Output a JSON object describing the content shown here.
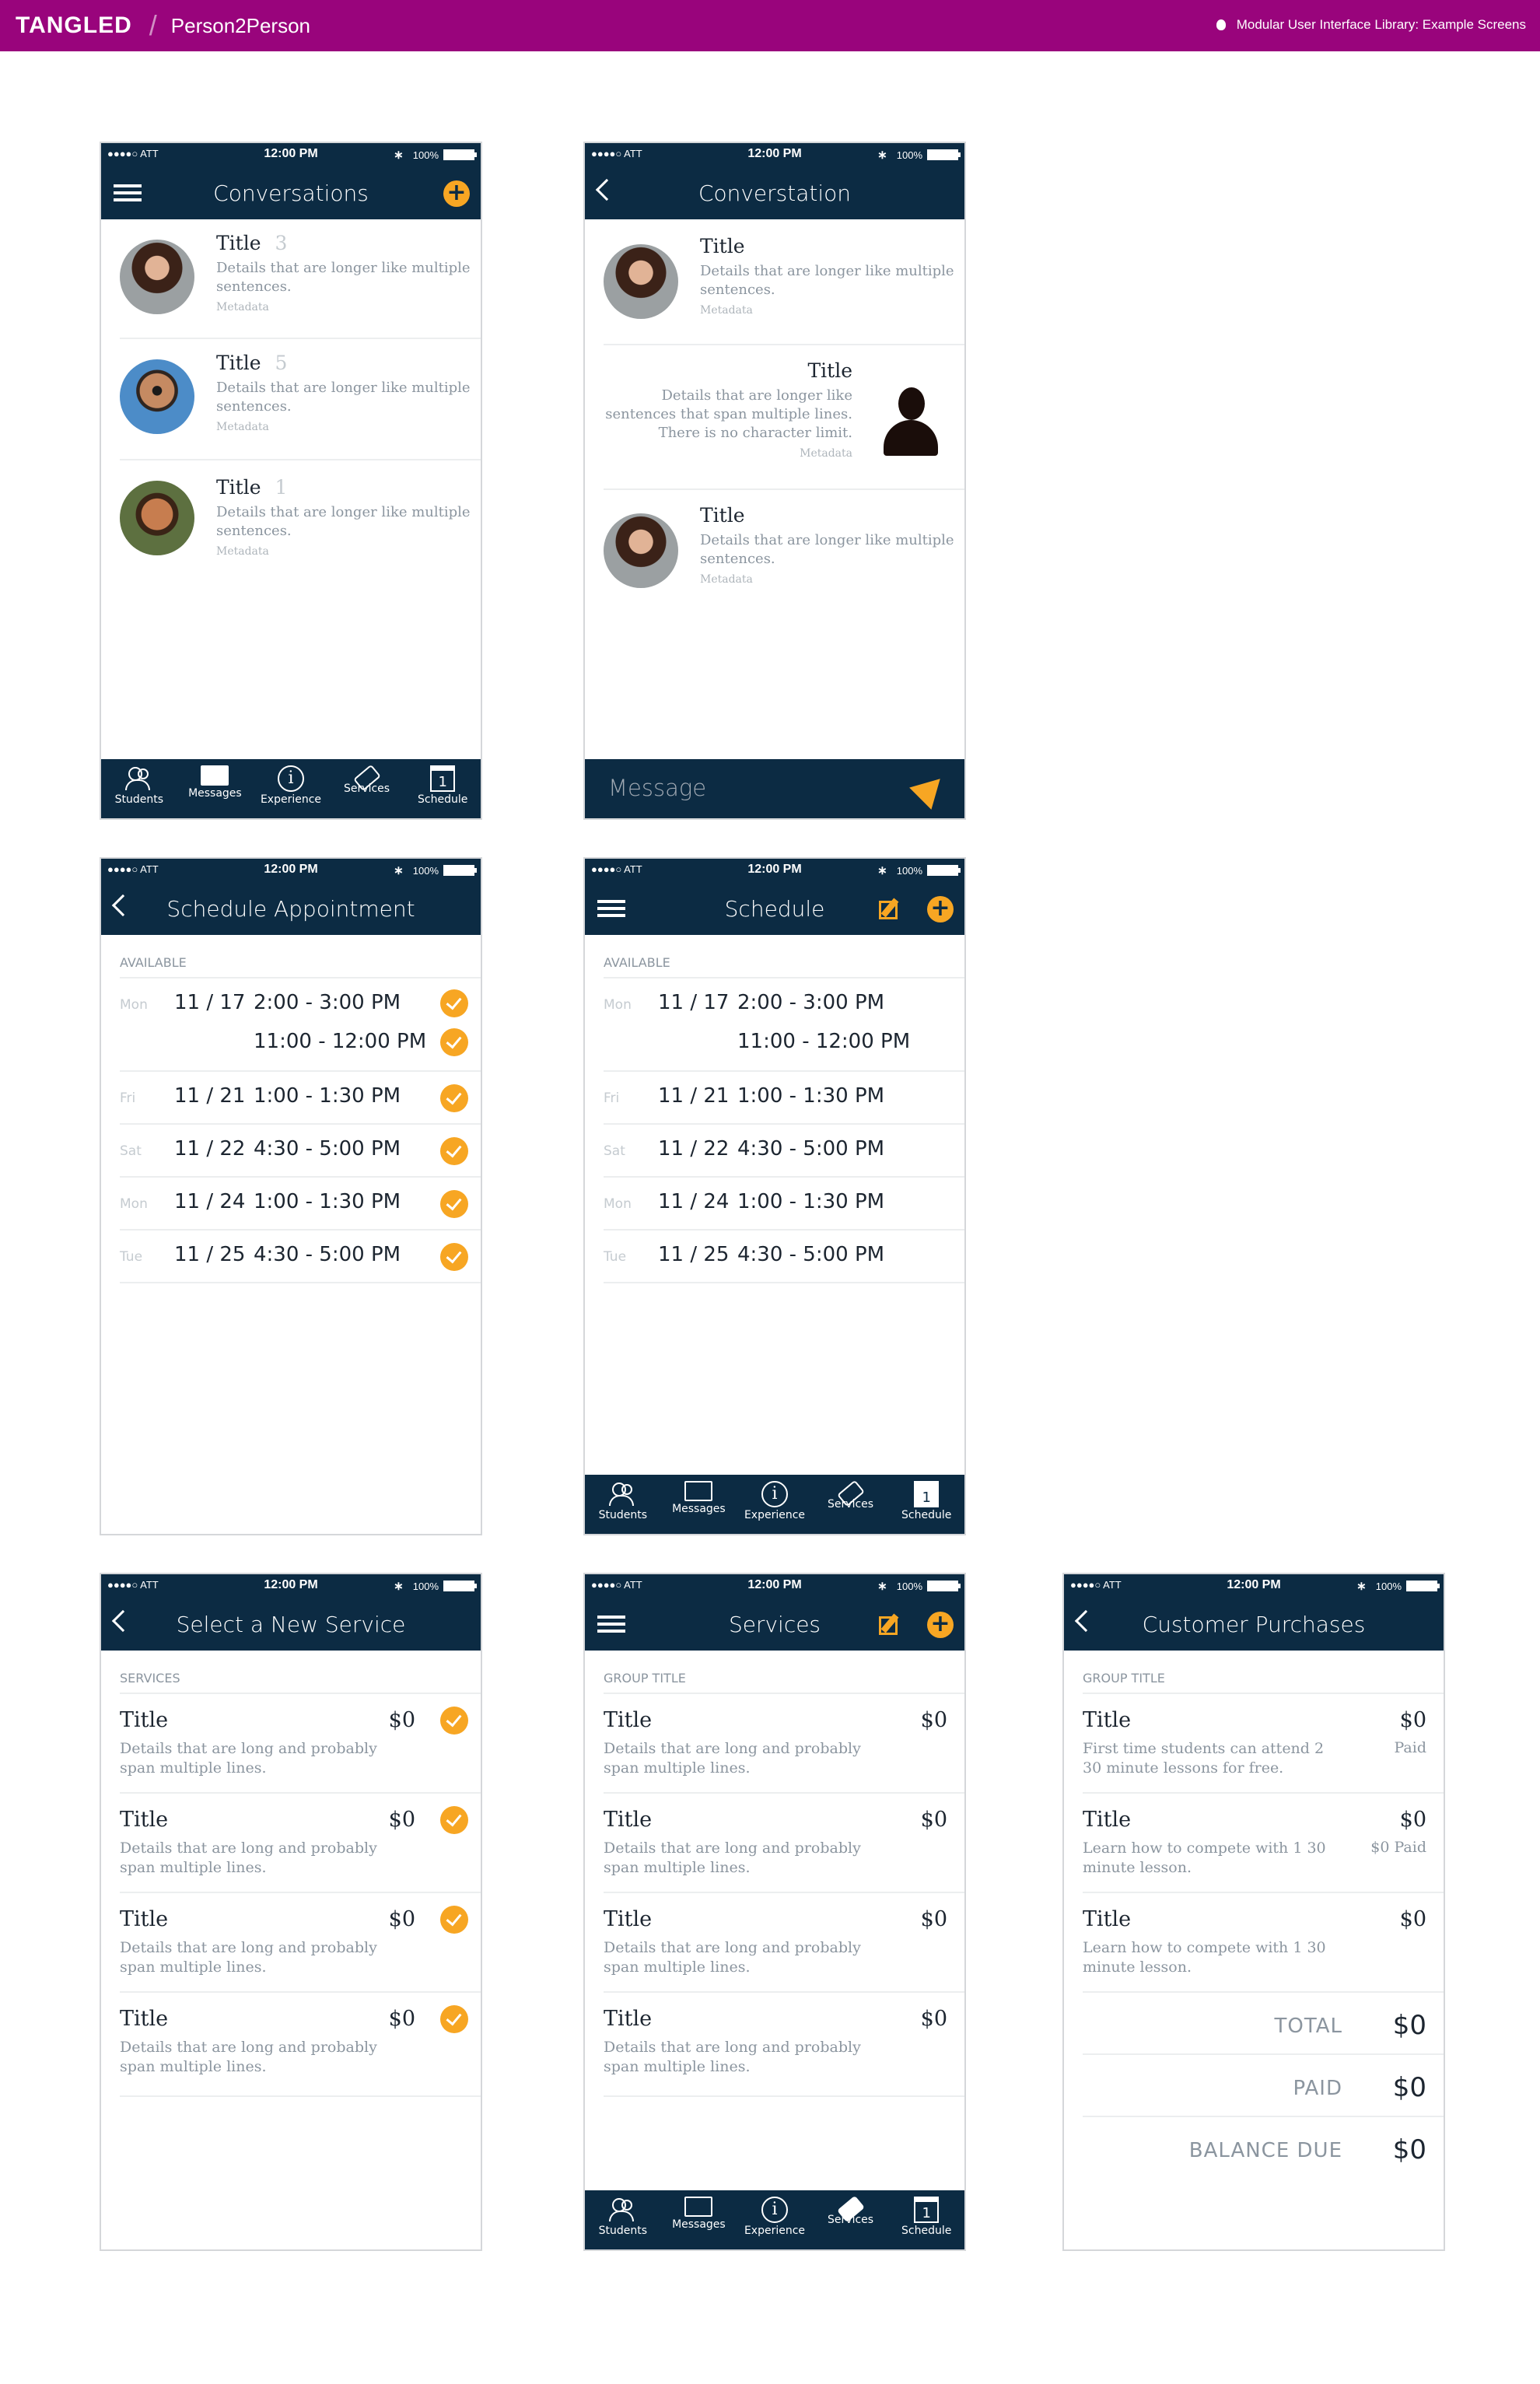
{
  "banner": {
    "brand": "TANGLED",
    "product": "Person2Person",
    "library": "Modular User Interface Library: Example Screens"
  },
  "status": {
    "carrier": "●●●●○ ATT",
    "time": "12:00 PM",
    "battery": "100%"
  },
  "tabs": [
    "Students",
    "Messages",
    "Experience",
    "Services",
    "Schedule"
  ],
  "conversations": {
    "title": "Conversations",
    "items": [
      {
        "title": "Title",
        "count": "3",
        "details": "Details that are longer like multiple sentences.",
        "meta": "Metadata"
      },
      {
        "title": "Title",
        "count": "5",
        "details": "Details that are longer like multiple sentences.",
        "meta": "Metadata"
      },
      {
        "title": "Title",
        "count": "1",
        "details": "Details that are longer like multiple sentences.",
        "meta": "Metadata"
      }
    ]
  },
  "conversation": {
    "title": "Converstation",
    "message_placeholder": "Message",
    "items": [
      {
        "title": "Title",
        "details": "Details that are longer like multiple sentences.",
        "meta": "Metadata"
      },
      {
        "title": "Title",
        "details": "Details that are longer like sentences that span multiple lines. There is no character limit.",
        "meta": "Metadata"
      },
      {
        "title": "Title",
        "details": "Details that are longer like multiple sentences.",
        "meta": "Metadata"
      }
    ]
  },
  "schedule_appointment": {
    "title": "Schedule Appointment",
    "section": "AVAILABLE"
  },
  "schedule": {
    "title": "Schedule",
    "section": "AVAILABLE"
  },
  "slots": [
    {
      "day": "Mon",
      "date": "11 / 17",
      "time": "2:00 - 3:00 PM"
    },
    {
      "day": "",
      "date": "",
      "time": "11:00 - 12:00 PM"
    },
    {
      "day": "Fri",
      "date": "11 / 21",
      "time": "1:00 - 1:30 PM"
    },
    {
      "day": "Sat",
      "date": "11 / 22",
      "time": "4:30 - 5:00 PM"
    },
    {
      "day": "Mon",
      "date": "11 / 24",
      "time": "1:00 - 1:30 PM"
    },
    {
      "day": "Tue",
      "date": "11 / 25",
      "time": "4:30 - 5:00 PM"
    }
  ],
  "select_service": {
    "title": "Select a New Service",
    "section": "SERVICES",
    "items": [
      {
        "title": "Title",
        "price": "$0",
        "details": "Details that are long and probably span multiple lines."
      },
      {
        "title": "Title",
        "price": "$0",
        "details": "Details that are long and probably span multiple lines."
      },
      {
        "title": "Title",
        "price": "$0",
        "details": "Details that are long and probably span multiple lines."
      },
      {
        "title": "Title",
        "price": "$0",
        "details": "Details that are long and probably span multiple lines."
      }
    ]
  },
  "services": {
    "title": "Services",
    "section": "GROUP TITLE",
    "items": [
      {
        "title": "Title",
        "price": "$0",
        "details": "Details that are long and probably span multiple lines."
      },
      {
        "title": "Title",
        "price": "$0",
        "details": "Details that are long and probably span multiple lines."
      },
      {
        "title": "Title",
        "price": "$0",
        "details": "Details that are long and probably span multiple lines."
      },
      {
        "title": "Title",
        "price": "$0",
        "details": "Details that are long and probably span multiple lines."
      }
    ]
  },
  "purchases": {
    "title": "Customer Purchases",
    "section": "GROUP TITLE",
    "items": [
      {
        "title": "Title",
        "price": "$0",
        "details": "First time students can attend 2 30 minute lessons for free.",
        "status": "Paid"
      },
      {
        "title": "Title",
        "price": "$0",
        "details": "Learn how to compete with 1 30 minute lesson.",
        "status": "$0 Paid"
      },
      {
        "title": "Title",
        "price": "$0",
        "details": "Learn how to compete with 1 30 minute lesson.",
        "status": ""
      }
    ],
    "totals": [
      {
        "label": "TOTAL",
        "value": "$0"
      },
      {
        "label": "PAID",
        "value": "$0"
      },
      {
        "label": "BALANCE DUE",
        "value": "$0"
      }
    ]
  }
}
